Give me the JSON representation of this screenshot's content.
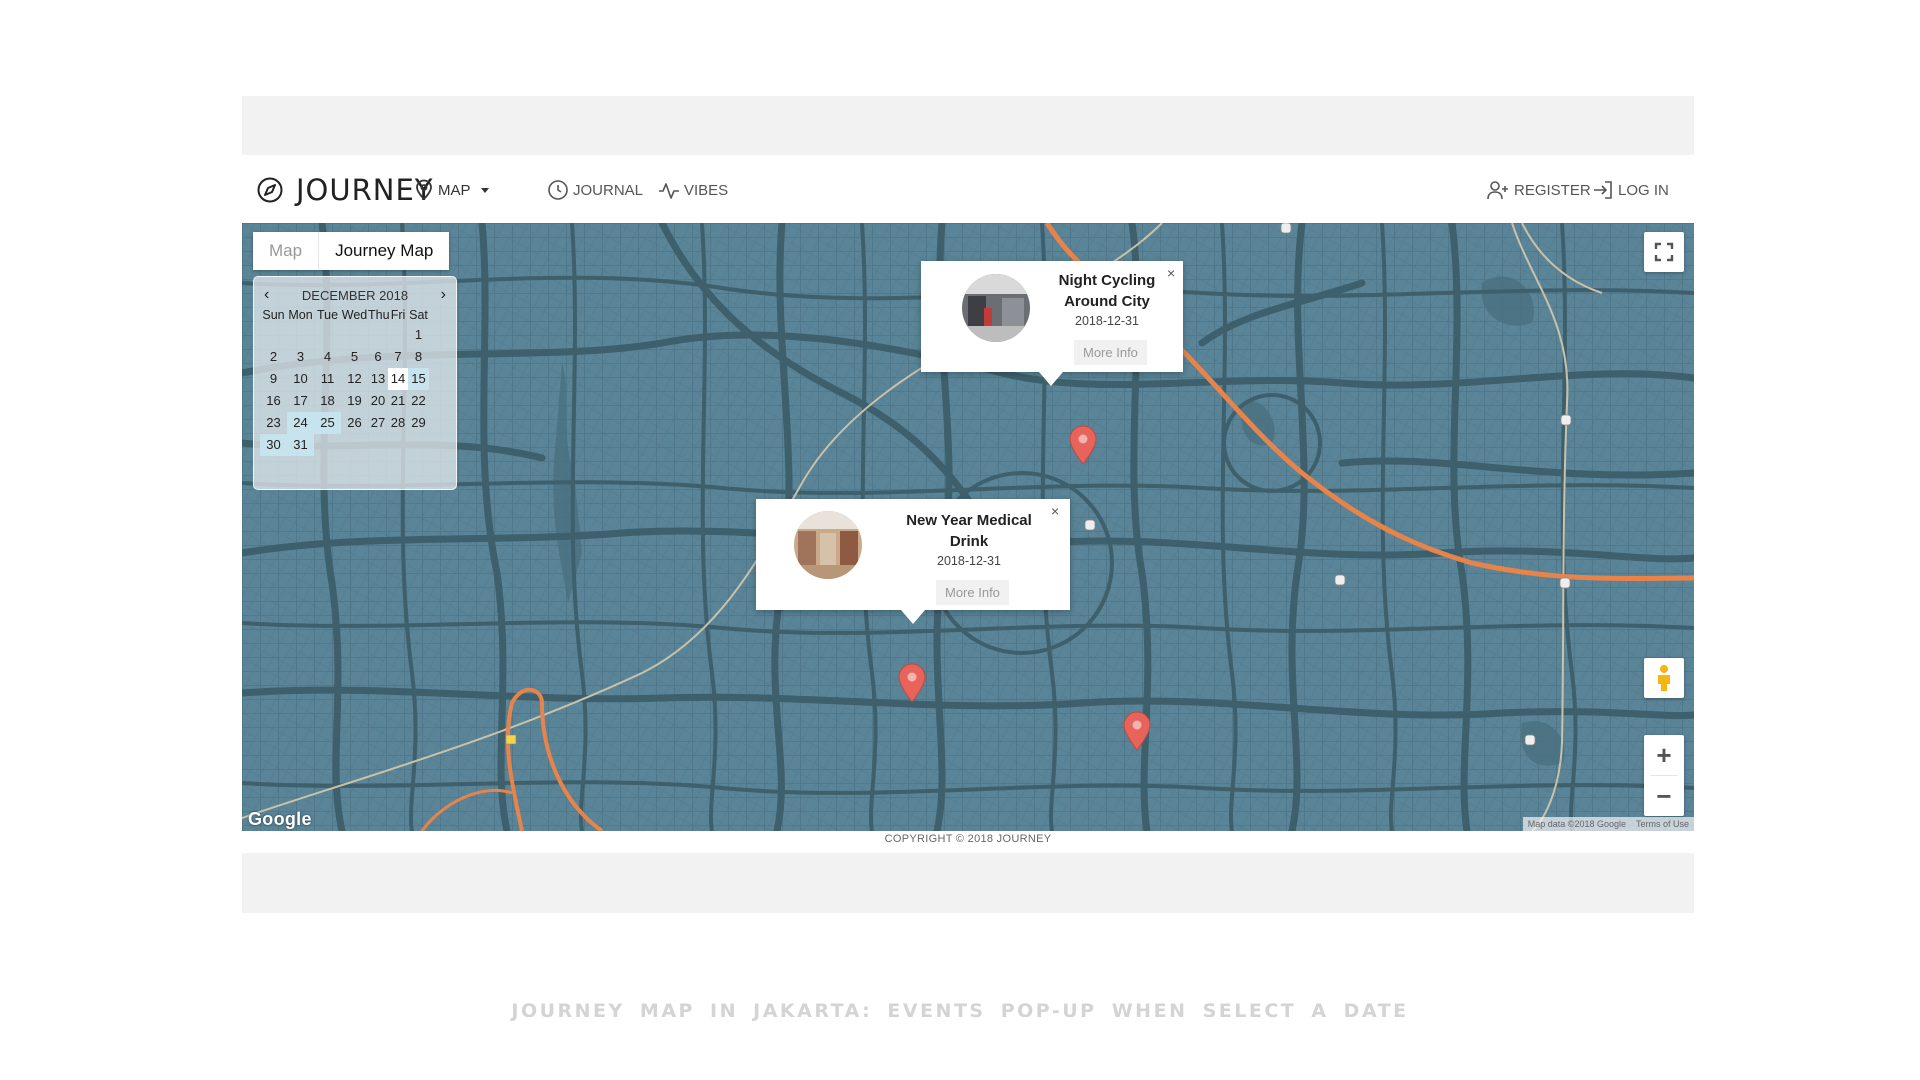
{
  "brand": {
    "name": "JOURNEY",
    "icon": "compass-icon"
  },
  "nav": {
    "map": {
      "label": "MAP",
      "icon": "map-pin-icon"
    },
    "journal": {
      "label": "JOURNAL",
      "icon": "clock-icon"
    },
    "vibes": {
      "label": "VIBES",
      "icon": "activity-icon"
    },
    "register": {
      "label": "REGISTER",
      "icon": "user-plus-icon"
    },
    "login": {
      "label": "LOG IN",
      "icon": "log-in-icon"
    }
  },
  "map_type": {
    "map_label": "Map",
    "journey_label": "Journey Map"
  },
  "calendar": {
    "month": "DECEMBER 2018",
    "prev": "‹",
    "next": "›",
    "weekdays": [
      "Sun",
      "Mon",
      "Tue",
      "Wed",
      "Thu",
      "Fri",
      "Sat"
    ],
    "weeks": [
      [
        "",
        "",
        "",
        "",
        "",
        "",
        "1"
      ],
      [
        "2",
        "3",
        "4",
        "5",
        "6",
        "7",
        "8"
      ],
      [
        "9",
        "10",
        "11",
        "12",
        "13",
        "14",
        "15"
      ],
      [
        "16",
        "17",
        "18",
        "19",
        "20",
        "21",
        "22"
      ],
      [
        "23",
        "24",
        "25",
        "26",
        "27",
        "28",
        "29"
      ],
      [
        "30",
        "31",
        "",
        "",
        "",
        "",
        ""
      ]
    ],
    "highlighted_days": [
      "15",
      "24",
      "25",
      "30",
      "31"
    ],
    "today": "14"
  },
  "popups": [
    {
      "title": "Night Cycling Around City",
      "date": "2018-12-31",
      "more": "More Info",
      "close": "×"
    },
    {
      "title": "New Year Medical Drink",
      "date": "2018-12-31",
      "more": "More Info",
      "close": "×"
    }
  ],
  "map_controls": {
    "zoom_in": "+",
    "zoom_out": "−",
    "fullscreen_icon": "fullscreen-icon",
    "pegman_icon": "pegman-icon"
  },
  "map_attribution": {
    "logo": "Google",
    "data": "Map data ©2018 Google",
    "terms": "Terms of Use"
  },
  "copyright": "COPYRIGHT © 2018 JOURNEY",
  "caption": "JOURNEY MAP IN JAKARTA: EVENTS POP-UP WHEN SELECT A DATE",
  "colors": {
    "map_water": "#567f92",
    "roads": "#3e5f6c",
    "highway": "#e8834a",
    "marker": "#e8635a"
  }
}
